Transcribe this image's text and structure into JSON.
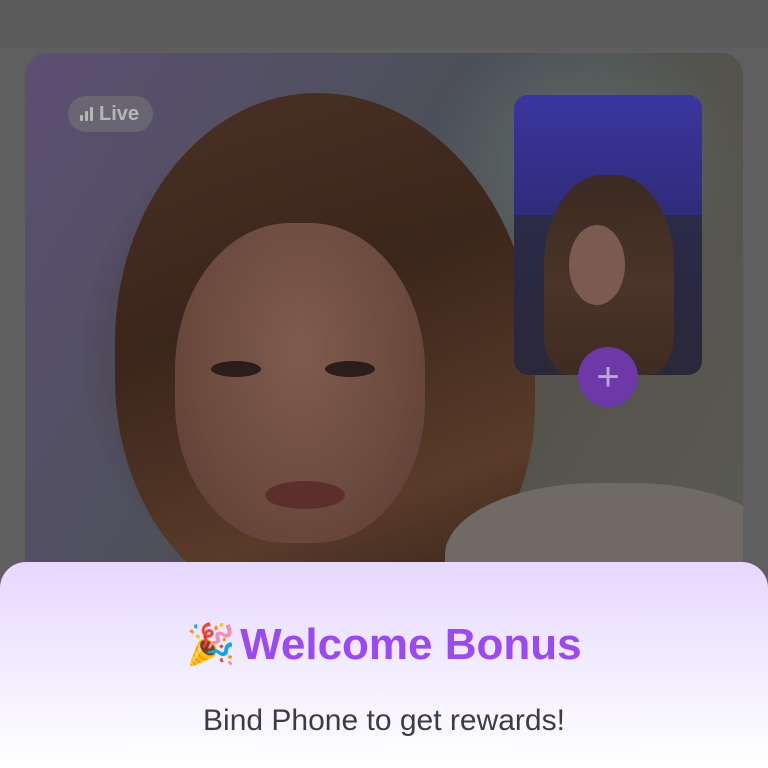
{
  "video": {
    "live_label": "Live",
    "pip_action_symbol": "+"
  },
  "bonus_sheet": {
    "icon": "🎉",
    "title": "Welcome Bonus",
    "subtitle": "Bind Phone to get rewards!"
  },
  "colors": {
    "accent": "#9b48f5",
    "pip_button": "#6d38a8",
    "sheet_top": "#e6d8ff"
  }
}
